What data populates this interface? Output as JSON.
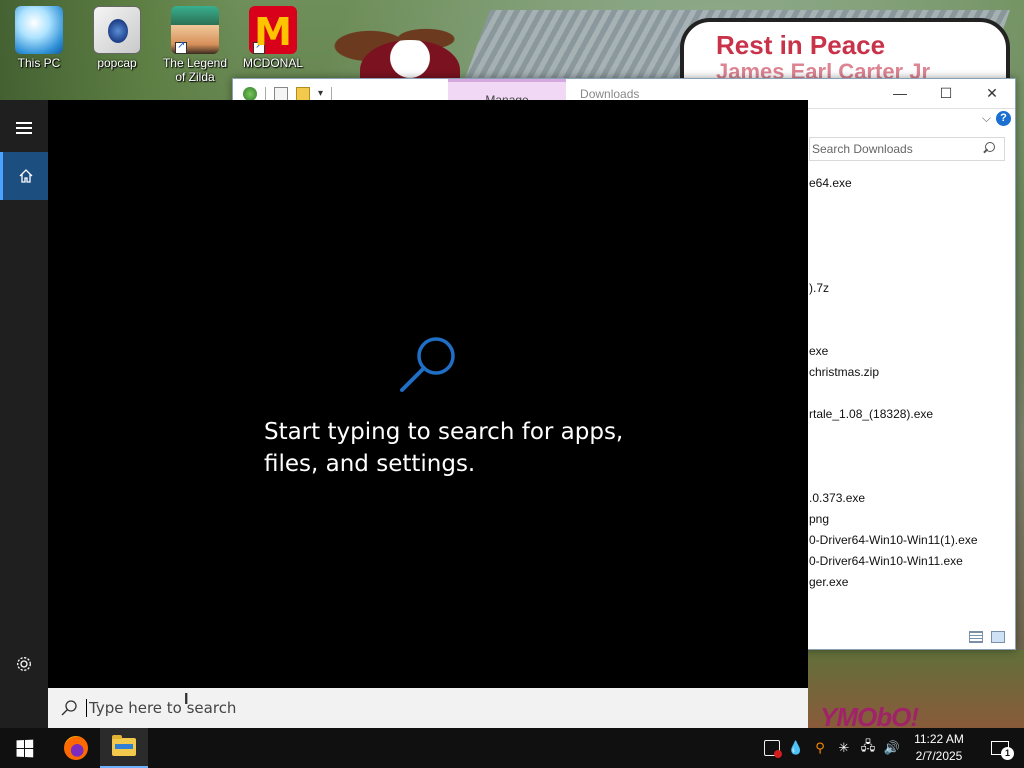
{
  "desktop": {
    "icons": [
      {
        "label": "This PC"
      },
      {
        "label": "popcap"
      },
      {
        "label": "The Legend of Zilda"
      },
      {
        "label": "MCDONAL"
      }
    ],
    "wallpaper_sign": "Rest in Peace",
    "wallpaper_sign_sub": "James Earl Carter Jr",
    "wallpaper_graffiti": "YMObO!"
  },
  "explorer": {
    "ribbon_tab": "Manage",
    "title": "Downloads",
    "window_buttons": {
      "minimize": "—",
      "maximize": "☐",
      "close": "✕"
    },
    "help": "?",
    "search_placeholder": "Search Downloads",
    "files": [
      "e64.exe",
      ").7z",
      "exe",
      "christmas.zip",
      "rtale_1.08_(18328).exe",
      ".0.373.exe",
      "png",
      "0-Driver64-Win10-Win11(1).exe",
      "0-Driver64-Win10-Win11.exe",
      "ger.exe"
    ]
  },
  "start": {
    "hint": "Start typing to search for apps, files, and settings.",
    "search_placeholder": "Type here to search"
  },
  "taskbar": {
    "time": "11:22 AM",
    "date": "2/7/2025",
    "notifications_count": "1"
  },
  "colors": {
    "accent": "#1c4e7f",
    "search_icon": "#1f6fc6",
    "taskbar": "#101010"
  }
}
